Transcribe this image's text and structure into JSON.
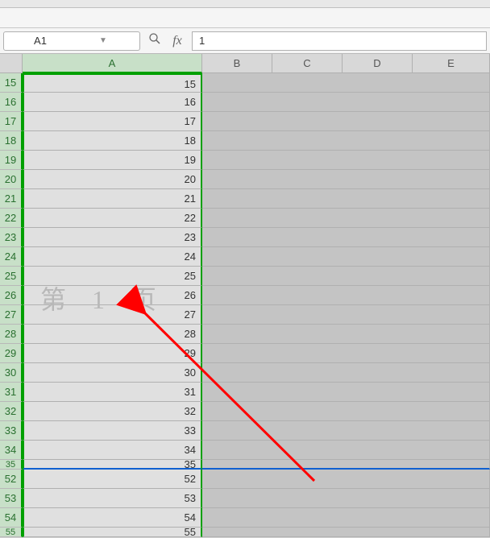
{
  "nameBox": {
    "value": "A1"
  },
  "formulaBar": {
    "value": "1"
  },
  "columns": [
    "A",
    "B",
    "C",
    "D",
    "E"
  ],
  "selectedColumn": "A",
  "watermark": "第 1 页",
  "rows": [
    {
      "num": 15,
      "val": "15",
      "short": false,
      "pb": false
    },
    {
      "num": 16,
      "val": "16",
      "short": false,
      "pb": false
    },
    {
      "num": 17,
      "val": "17",
      "short": false,
      "pb": false
    },
    {
      "num": 18,
      "val": "18",
      "short": false,
      "pb": false
    },
    {
      "num": 19,
      "val": "19",
      "short": false,
      "pb": false
    },
    {
      "num": 20,
      "val": "20",
      "short": false,
      "pb": false
    },
    {
      "num": 21,
      "val": "21",
      "short": false,
      "pb": false
    },
    {
      "num": 22,
      "val": "22",
      "short": false,
      "pb": false
    },
    {
      "num": 23,
      "val": "23",
      "short": false,
      "pb": false
    },
    {
      "num": 24,
      "val": "24",
      "short": false,
      "pb": false
    },
    {
      "num": 25,
      "val": "25",
      "short": false,
      "pb": false
    },
    {
      "num": 26,
      "val": "26",
      "short": false,
      "pb": false
    },
    {
      "num": 27,
      "val": "27",
      "short": false,
      "pb": false
    },
    {
      "num": 28,
      "val": "28",
      "short": false,
      "pb": false
    },
    {
      "num": 29,
      "val": "29",
      "short": false,
      "pb": false
    },
    {
      "num": 30,
      "val": "30",
      "short": false,
      "pb": false
    },
    {
      "num": 31,
      "val": "31",
      "short": false,
      "pb": false
    },
    {
      "num": 32,
      "val": "32",
      "short": false,
      "pb": false
    },
    {
      "num": 33,
      "val": "33",
      "short": false,
      "pb": false
    },
    {
      "num": 34,
      "val": "34",
      "short": false,
      "pb": false
    },
    {
      "num": 35,
      "val": "35",
      "short": true,
      "pb": true
    },
    {
      "num": 52,
      "val": "52",
      "short": false,
      "pb": false
    },
    {
      "num": 53,
      "val": "53",
      "short": false,
      "pb": false
    },
    {
      "num": 54,
      "val": "54",
      "short": false,
      "pb": false
    },
    {
      "num": 55,
      "val": "55",
      "short": true,
      "pb": false
    }
  ]
}
